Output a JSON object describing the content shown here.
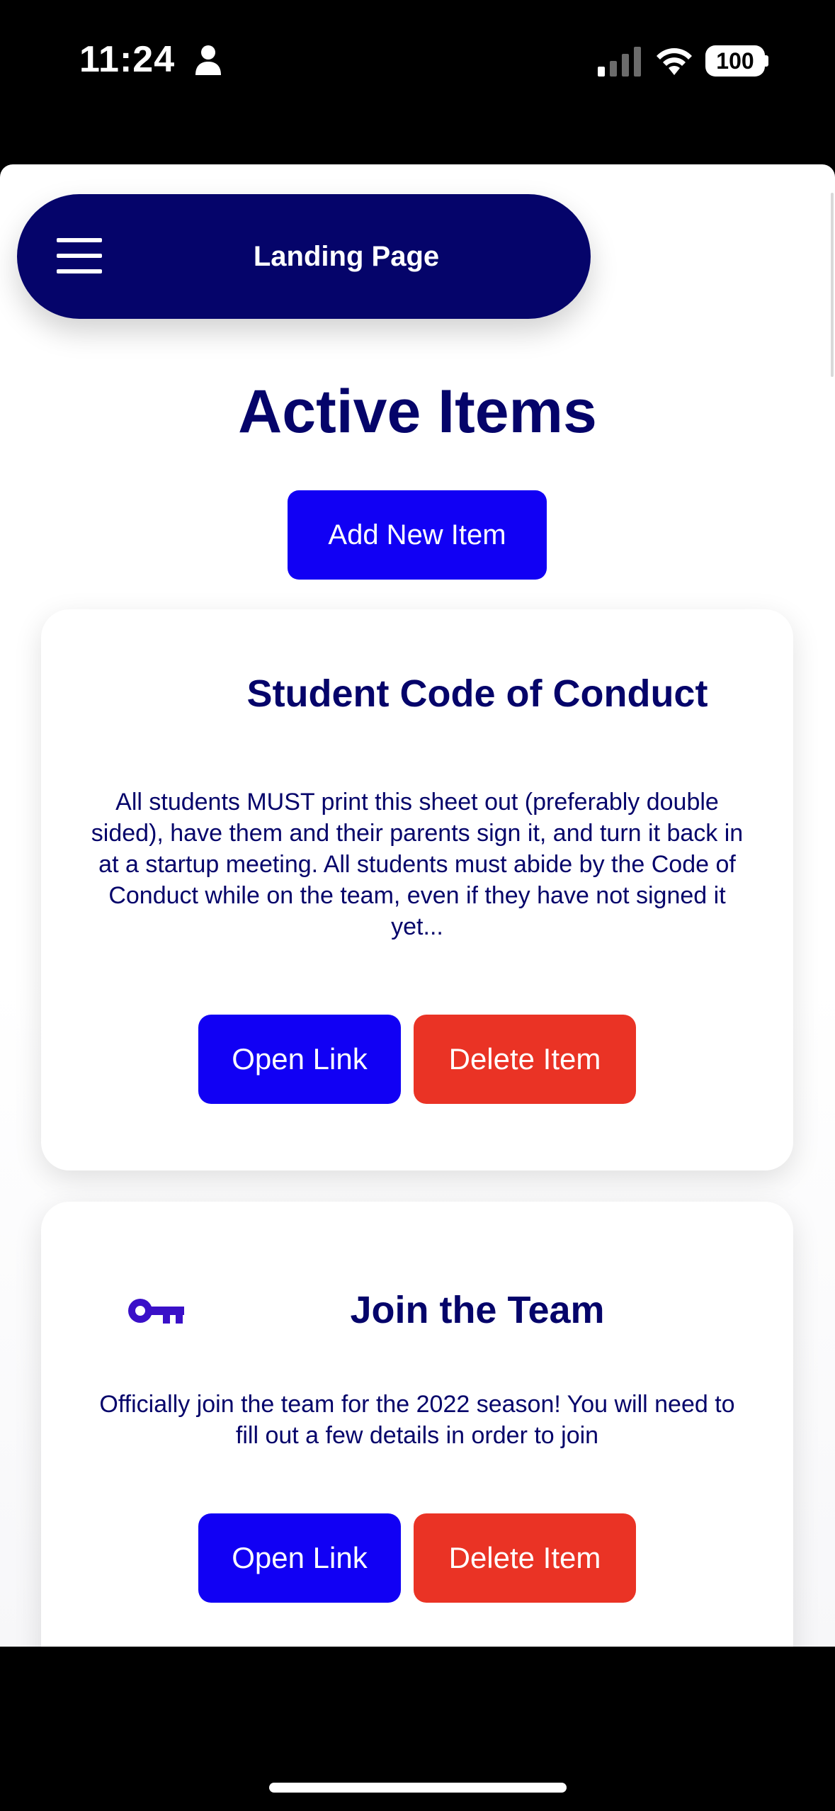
{
  "status_bar": {
    "time": "11:24",
    "battery": "100",
    "icons": [
      "person-icon",
      "cellular-signal-icon",
      "wifi-icon",
      "battery-icon"
    ]
  },
  "header": {
    "title": "Landing Page",
    "menu_icon": "hamburger-menu-icon"
  },
  "main": {
    "title": "Active Items",
    "add_button_label": "Add New Item"
  },
  "items": [
    {
      "title": "Student Code of Conduct",
      "description": "All students MUST print this sheet out (preferably double sided), have them and their parents sign it, and turn it back in at a startup meeting. All students must abide by the Code of Conduct while on the team, even if they have not signed it yet...",
      "open_label": "Open Link",
      "delete_label": "Delete Item"
    },
    {
      "icon": "key-icon",
      "title": "Join the Team",
      "description": "Officially join the team for the 2022 season! You will need to fill out a few details in order to join",
      "open_label": "Open Link",
      "delete_label": "Delete Item"
    }
  ],
  "colors": {
    "navy": "#05046a",
    "primary_blue": "#1100f4",
    "danger_red": "#ea3325",
    "key_icon": "#3a10c8"
  }
}
